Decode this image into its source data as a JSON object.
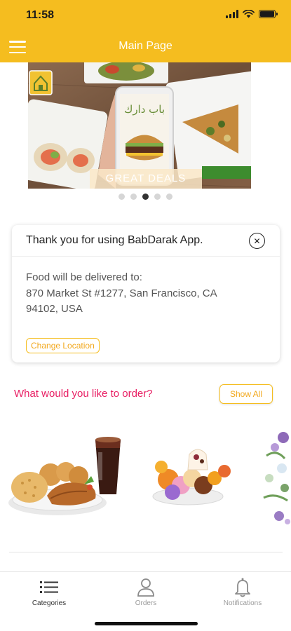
{
  "status_bar": {
    "time": "11:58"
  },
  "header": {
    "title": "Main Page",
    "menu_icon": "hamburger-menu-icon"
  },
  "banner": {
    "caption": "GREAT DEALS",
    "logo_text": "باب دارك",
    "slides_total": 5,
    "active_slide": 3
  },
  "notice": {
    "title": "Thank you for using BabDarak App.",
    "close_icon": "close-circle-icon",
    "delivery_label": "Food will be delivered to:",
    "delivery_address": "870 Market St #1277, San Francisco, CA 94102, USA",
    "change_button": "Change Location"
  },
  "order_section": {
    "prompt": "What would you like to order?",
    "show_all": "Show All"
  },
  "tabbar": {
    "tabs": [
      {
        "label": "Categories",
        "icon": "list-icon",
        "active": true
      },
      {
        "label": "Orders",
        "icon": "user-icon",
        "active": false
      },
      {
        "label": "Notifications",
        "icon": "bell-icon",
        "active": false
      }
    ]
  },
  "colors": {
    "brand_yellow": "#F5BD1F",
    "accent_pink": "#E81E63",
    "button_text": "#F2A81D"
  }
}
